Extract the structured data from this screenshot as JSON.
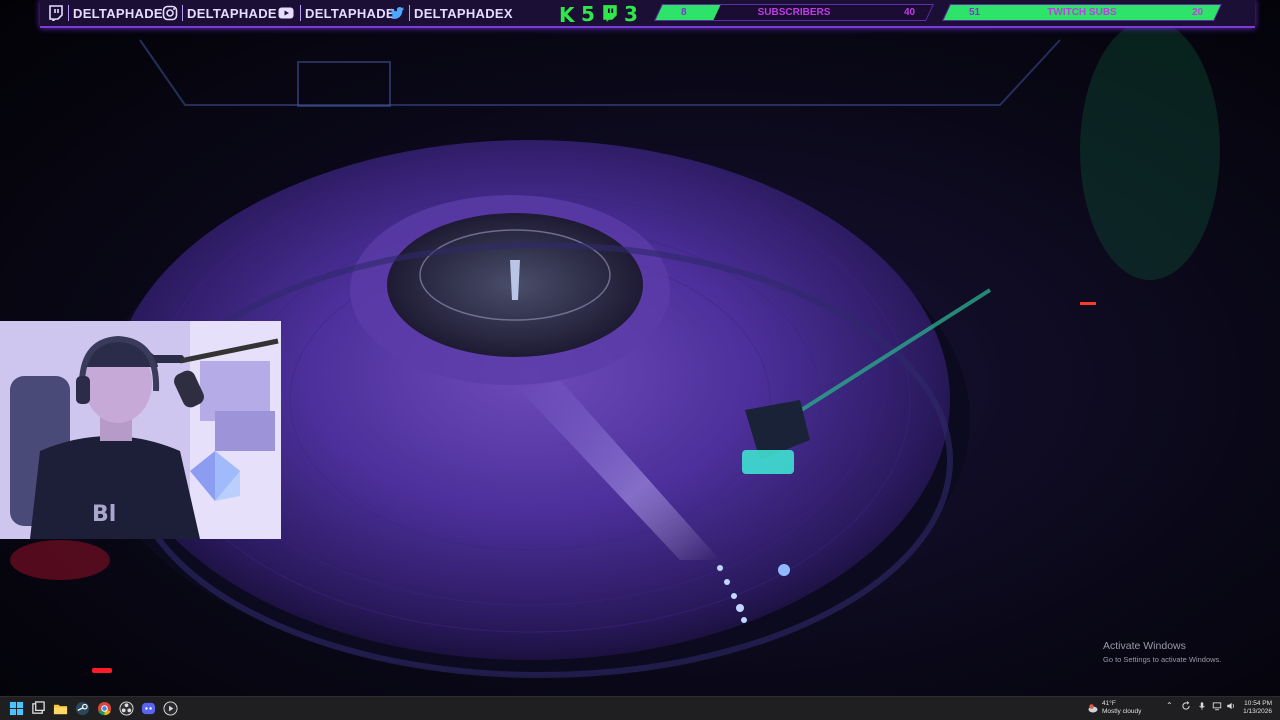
{
  "overlay": {
    "socials": [
      {
        "icon": "twitch-icon",
        "handle": "DELTAPHADE"
      },
      {
        "icon": "instagram-icon",
        "handle": "DELTAPHADE"
      },
      {
        "icon": "youtube-icon",
        "handle": "DELTAPHADE"
      },
      {
        "icon": "twitter-icon",
        "handle": "DELTAPHADEX"
      }
    ],
    "kick_count": "5",
    "twitch_count": "3",
    "goals": [
      {
        "label": "SUBSCRIBERS",
        "current": "8",
        "target": "40",
        "progress": 0.2
      },
      {
        "label": "TWITCH SUBS",
        "current": "51",
        "target": "20",
        "progress": 1.0
      }
    ],
    "accent_color": "#7b3bd6",
    "goal_color": "#2de36a"
  },
  "watermark": {
    "title": "Activate Windows",
    "subtitle": "Go to Settings to activate Windows."
  },
  "taskbar": {
    "apps": [
      "windows-start-icon",
      "task-view-icon",
      "file-explorer-icon",
      "steam-icon",
      "chrome-icon",
      "obs-icon",
      "discord-icon",
      "media-player-icon"
    ],
    "weather_temp": "41°F",
    "weather_desc": "Mostly cloudy",
    "time": "10:54 PM",
    "date": "1/13/2026"
  }
}
